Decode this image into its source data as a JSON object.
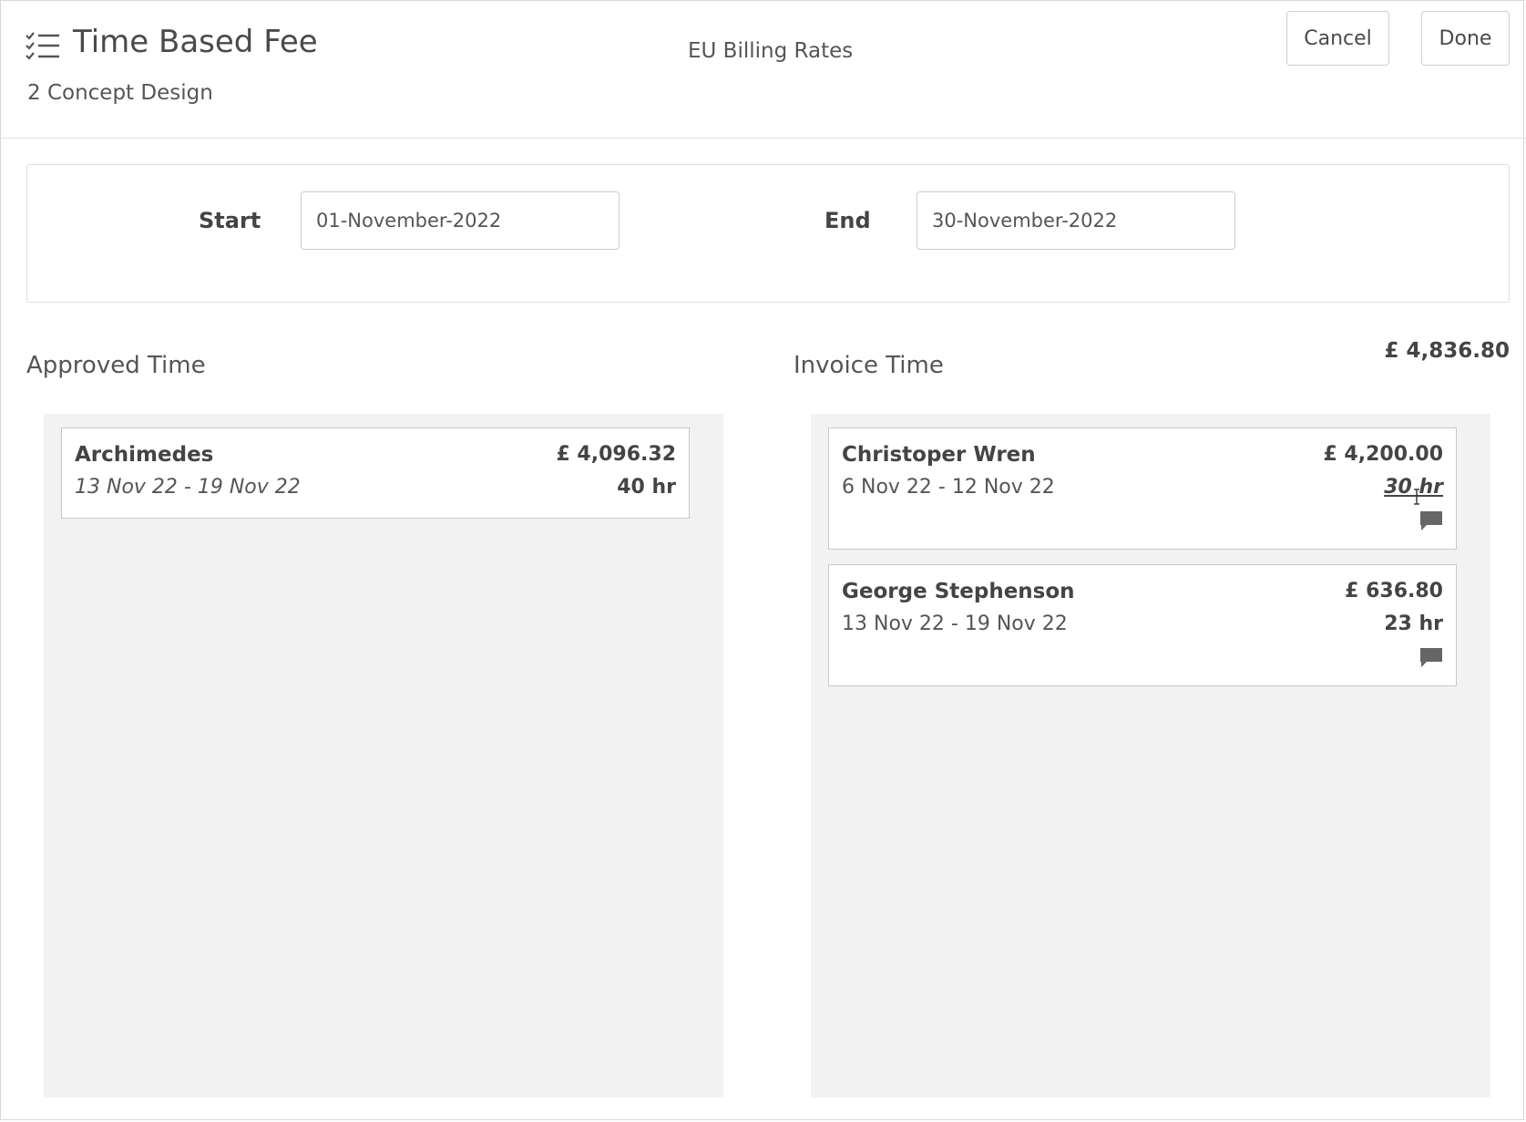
{
  "header": {
    "icon": "checklist-icon",
    "title": "Time Based Fee",
    "subtitle": "2 Concept Design",
    "rate_name": "EU Billing Rates",
    "cancel_label": "Cancel",
    "done_label": "Done"
  },
  "dates": {
    "start_label": "Start",
    "start_value": "01-November-2022",
    "end_label": "End",
    "end_value": "30-November-2022"
  },
  "approved": {
    "title": "Approved Time",
    "items": [
      {
        "name": "Archimedes",
        "dates": "13 Nov 22 - 19 Nov 22",
        "amount": "£ 4,096.32",
        "hours": "40 hr"
      }
    ]
  },
  "invoice": {
    "title": "Invoice Time",
    "total": "£ 4,836.80",
    "items": [
      {
        "name": "Christoper Wren",
        "dates": "6 Nov 22 - 12 Nov 22",
        "amount": "£ 4,200.00",
        "hours": "30 hr",
        "icon": "comment-icon"
      },
      {
        "name": "George Stephenson",
        "dates": "13 Nov 22 - 19 Nov 22",
        "amount": "£ 636.80",
        "hours": "23 hr",
        "icon": "comment-icon"
      }
    ]
  },
  "colors": {
    "text": "#4a4a4a",
    "column_bg": "#f2f2f2",
    "border": "#cccccc",
    "icon": "#666666"
  }
}
